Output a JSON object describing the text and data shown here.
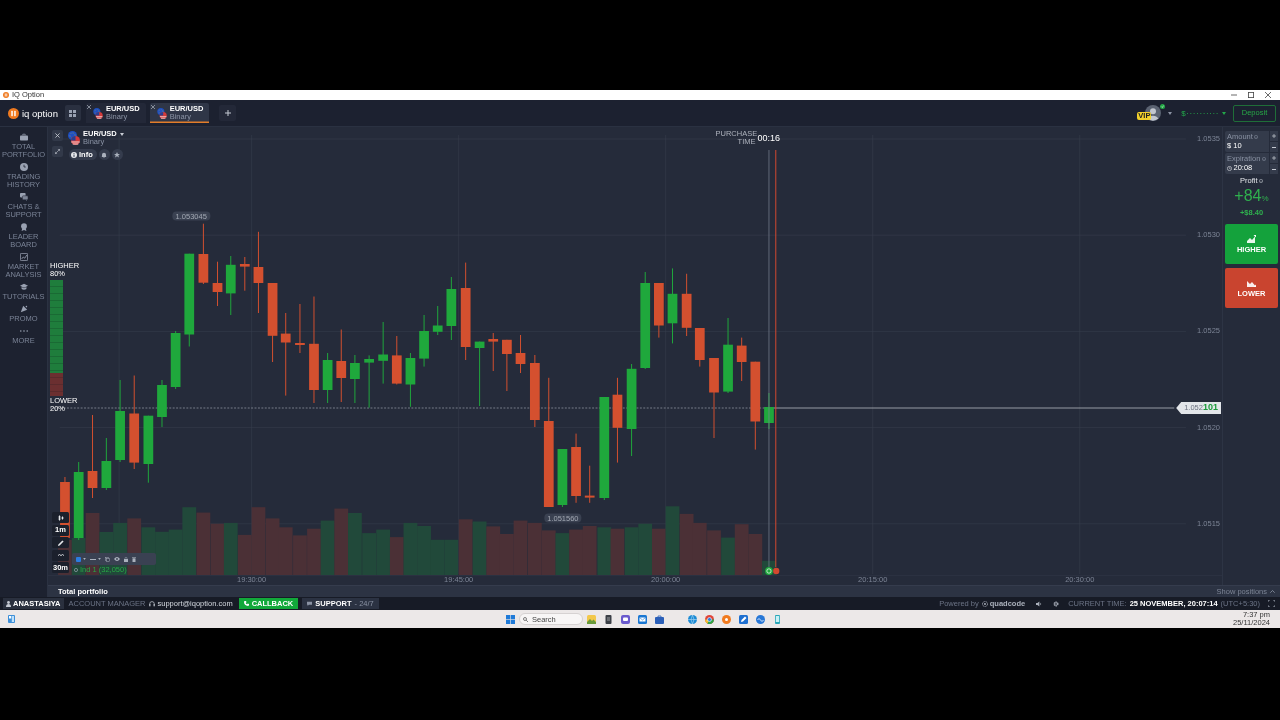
{
  "window": {
    "title": "IQ Option"
  },
  "header": {
    "logo_text": "iq option",
    "tabs": [
      {
        "pair": "EUR/USD",
        "type": "Binary",
        "selected": false
      },
      {
        "pair": "EUR/USD",
        "type": "Binary",
        "selected": true
      }
    ],
    "vip_badge": "VIP",
    "balance": "$··········",
    "deposit": "Deposit"
  },
  "sidebar": {
    "items": [
      {
        "label": "TOTAL PORTFOLIO",
        "selected": false
      },
      {
        "label": "TRADING HISTORY",
        "selected": false
      },
      {
        "label": "CHATS & SUPPORT",
        "selected": false
      },
      {
        "label": "LEADER BOARD",
        "selected": false
      },
      {
        "label": "MARKET ANALYSIS",
        "selected": false
      },
      {
        "label": "TUTORIALS",
        "selected": false
      },
      {
        "label": "PROMO",
        "selected": false
      },
      {
        "label": "MORE",
        "selected": false
      }
    ]
  },
  "chart": {
    "asset": {
      "pair": "EUR/USD",
      "type": "Binary"
    },
    "info_button": "Info",
    "purchase_time": {
      "label": "PURCHASE TIME",
      "value": "00:16"
    },
    "sentiment": {
      "higher_label": "HIGHER",
      "higher_share": "80%",
      "lower_label": "LOWER",
      "lower_share": "20%",
      "level": 0.8
    },
    "high_label": "1.053045",
    "low_label": "1.051560",
    "current_price": "1.052**101**",
    "price_labels": [
      "1.0535",
      "1.0530",
      "1.0525",
      "1.0520",
      "1.0515"
    ],
    "time_labels": [
      "19:30:00",
      "19:45:00",
      "20:00:00",
      "20:15:00",
      "20:30:00"
    ],
    "candle_interval": "1m",
    "chart_period": "30m",
    "indicator_label": "Ind 1 (32,050)"
  },
  "trade_panel": {
    "amount": {
      "label": "Amount",
      "value": "$ 10"
    },
    "expiration": {
      "label": "Expiration",
      "value": "20:08"
    },
    "profit": {
      "label": "Profit",
      "percent": "+84",
      "percent_unit": "%",
      "amount": "+$8.40"
    },
    "buttons": [
      {
        "kind": "higher",
        "label": "HIGHER"
      },
      {
        "kind": "lower",
        "label": "LOWER"
      }
    ]
  },
  "portfolio_bar": {
    "title": "Total portfolio",
    "show_positions": "Show positions"
  },
  "footer": {
    "manager_name": "ANASTASIYA",
    "manager_role": "ACCOUNT MANAGER",
    "email": "support@iqoption.com",
    "callback": "CALLBACK",
    "support": "SUPPORT",
    "support_hours": "- 24/7",
    "powered_by": "Powered by",
    "brand": "quadcode",
    "current_time_label": "CURRENT TIME:",
    "current_time": "25 NOVEMBER, 20:07:14",
    "timezone": "(UTC+5:30)"
  },
  "taskbar": {
    "search_placeholder": "Search",
    "time": "7:37 pm",
    "date": "25/11/2024"
  }
}
